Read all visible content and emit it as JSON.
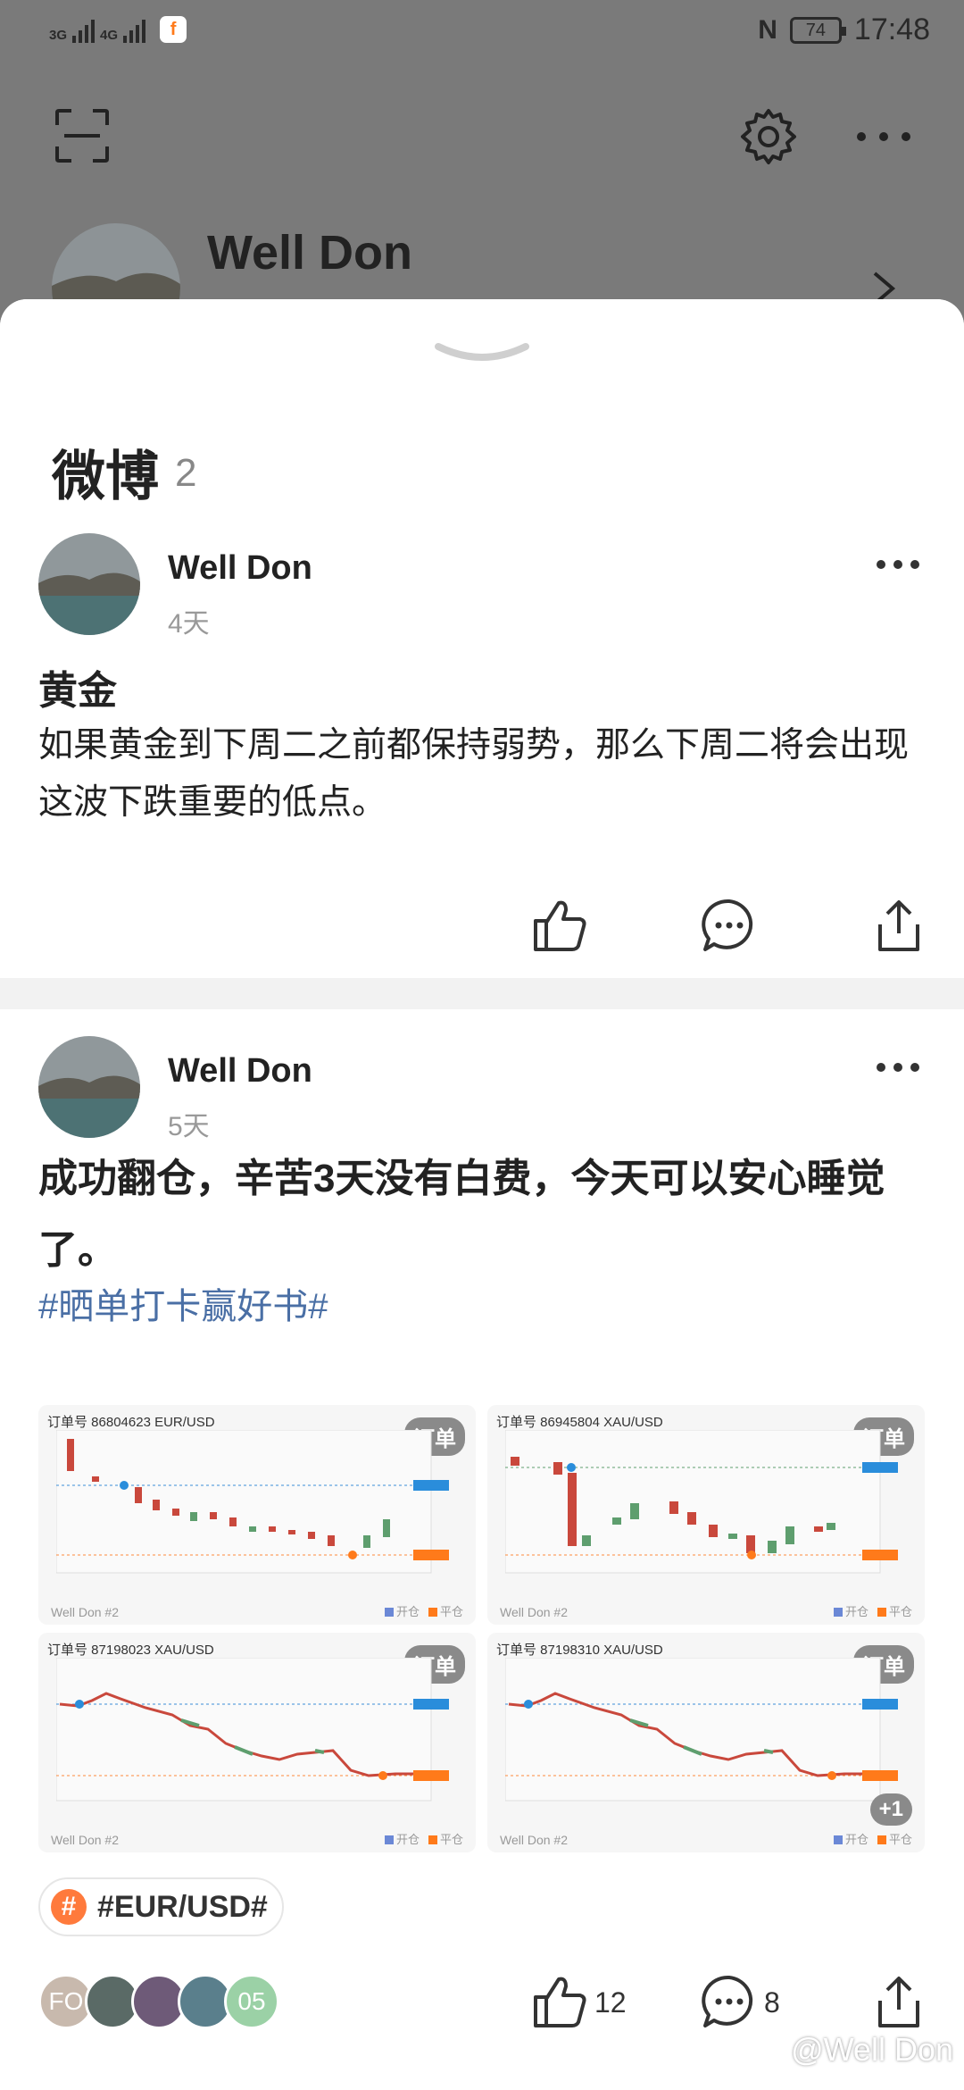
{
  "status_bar": {
    "net1": "3G",
    "net2": "4G",
    "app_badge": "f",
    "nfc": "N",
    "battery": "74",
    "time": "17:48"
  },
  "profile": {
    "name": "Well Don"
  },
  "section": {
    "title": "微博",
    "count": "2"
  },
  "posts": [
    {
      "author": "Well Don",
      "time": "4天",
      "title": "黄金",
      "body": "如果黄金到下周二之前都保持弱势，那么下周二将会出现这波下跌重要的低点。"
    },
    {
      "author": "Well Don",
      "time": "5天",
      "headline": "成功翻仓，辛苦3天没有白费，今天可以安心睡觉了。",
      "hashtag": "#晒单打卡赢好书#",
      "images": [
        {
          "order": "订单号 86804623    EUR/USD",
          "badge": "订单",
          "footer": "Well Don #2",
          "legend_open": "开仓",
          "legend_close": "平仓"
        },
        {
          "order": "订单号 86945804    XAU/USD",
          "badge": "订单",
          "footer": "Well Don #2",
          "legend_open": "开仓",
          "legend_close": "平仓"
        },
        {
          "order": "订单号 87198023    XAU/USD",
          "badge": "订单",
          "footer": "Well Don #2",
          "legend_open": "开仓",
          "legend_close": "平仓"
        },
        {
          "order": "订单号 87198310    XAU/USD",
          "badge": "订单",
          "footer": "Well Don #2",
          "legend_open": "开仓",
          "legend_close": "平仓",
          "more": "+1"
        }
      ],
      "topic": "#EUR/USD#",
      "topic_icon": "#",
      "likers": [
        "FO",
        "",
        "",
        "",
        "05"
      ],
      "like_count": "12",
      "comment_count": "8"
    }
  ],
  "watermark": "@Well Don",
  "colors": {
    "accent": "#ff7a3c",
    "link": "#4a6fa5",
    "up": "#5e9e6e",
    "down": "#c9483c"
  }
}
